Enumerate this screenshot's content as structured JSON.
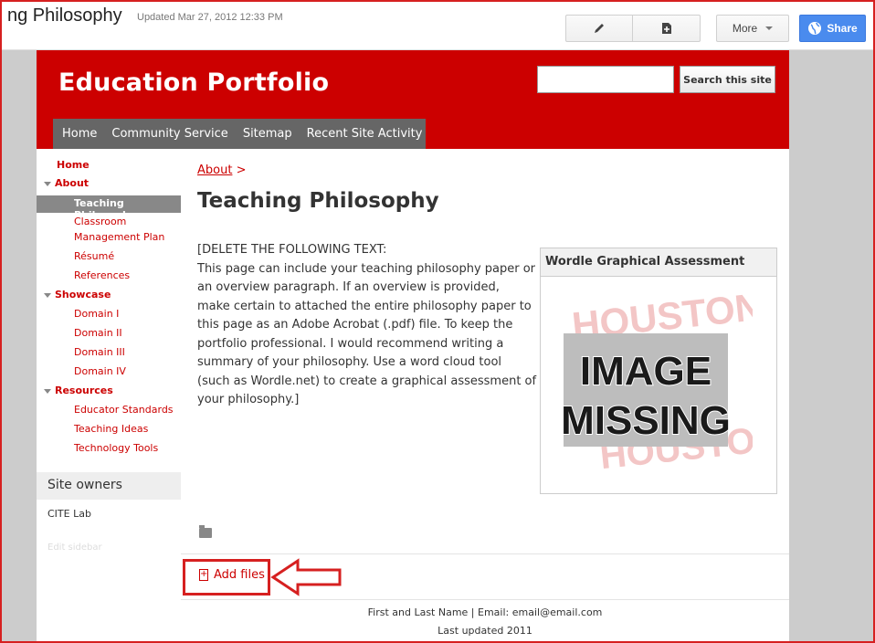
{
  "topbar": {
    "page_title": "ng Philosophy",
    "updated": "Updated Mar 27, 2012 12:33 PM",
    "more_label": "More",
    "share_label": "Share"
  },
  "site": {
    "title": "Education Portfolio",
    "search": {
      "placeholder": "",
      "value": "",
      "button_label": "Search this site"
    },
    "nav": [
      "Home",
      "Community Service",
      "Sitemap",
      "Recent Site Activity"
    ]
  },
  "sidebar": {
    "items": [
      {
        "label": "Home"
      },
      {
        "label": "About"
      },
      {
        "label": "Teaching Philosophy"
      },
      {
        "label": "Classroom"
      },
      {
        "label": "Management Plan"
      },
      {
        "label": "Résumé"
      },
      {
        "label": "References"
      },
      {
        "label": "Showcase"
      },
      {
        "label": "Domain I"
      },
      {
        "label": "Domain II"
      },
      {
        "label": "Domain III"
      },
      {
        "label": "Domain IV"
      },
      {
        "label": "Resources"
      },
      {
        "label": "Educator Standards"
      },
      {
        "label": "Teaching Ideas"
      },
      {
        "label": "Technology Tools"
      }
    ],
    "owners_heading": "Site owners",
    "owner": "CITE Lab",
    "edit_sidebar": "Edit sidebar"
  },
  "main": {
    "breadcrumb": "About",
    "breadcrumb_sep": ">",
    "page_title": "Teaching Philosophy",
    "body_lines": [
      "[DELETE THE FOLLOWING TEXT:",
      "This page can include your teaching philosophy paper or",
      "an overview paragraph. If an overview is provided,",
      "make certain to attached the entire philosophy paper to",
      "this page as an Adobe Acrobat (.pdf) file. To keep the",
      "portfolio professional. I would recommend writing a",
      "summary of your philosophy. Use a word cloud tool",
      "(such as Wordle.net) to create a graphical assessment of",
      "your philosophy.]"
    ],
    "gadget_title": "Wordle Graphical Assessment",
    "missing_image": {
      "line1": "IMAGE",
      "line2": "MISSING",
      "watermark_top": "HOUSTON",
      "watermark_bottom": "HOUSTON"
    },
    "add_files": "Add files"
  },
  "footer": {
    "line1": "First and Last Name | Email: email@email.com",
    "line2": "Last updated 2011"
  },
  "colors": {
    "brand_red": "#cc0000",
    "share_blue": "#4a8bee",
    "nav_grey": "#666666"
  }
}
